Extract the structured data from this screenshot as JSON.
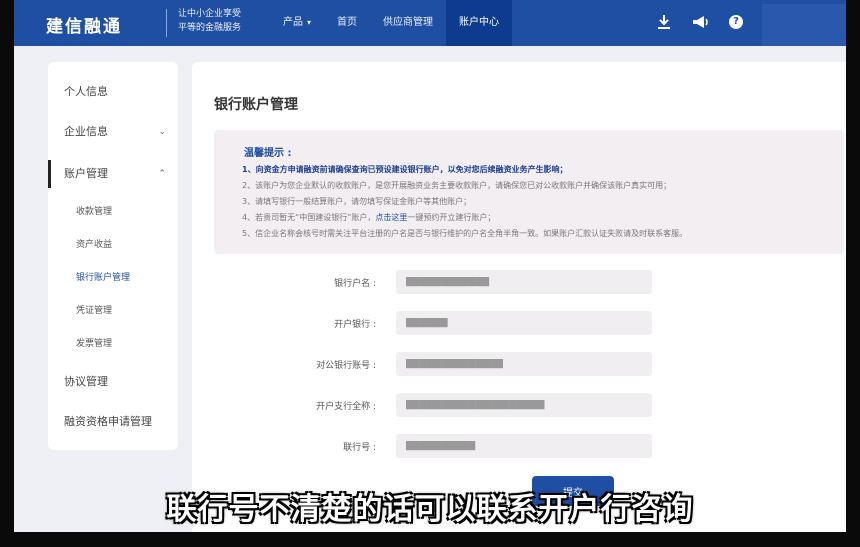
{
  "header": {
    "logo": "建信融通",
    "slogan_line1": "让中小企业享受",
    "slogan_line2": "平等的金融服务",
    "nav": [
      {
        "label": "产品",
        "has_dropdown": true
      },
      {
        "label": "首页"
      },
      {
        "label": "供应商管理"
      },
      {
        "label": "账户中心",
        "active": true
      }
    ],
    "icons": [
      "download-icon",
      "megaphone-icon",
      "help-icon"
    ],
    "help_glyph": "?"
  },
  "sidebar": {
    "items": [
      {
        "label": "个人信息"
      },
      {
        "label": "企业信息",
        "expand": "collapsed"
      },
      {
        "label": "账户管理",
        "expand": "expanded",
        "active": true
      },
      {
        "label": "协议管理"
      },
      {
        "label": "融资资格申请管理"
      }
    ],
    "sub_items": [
      {
        "label": "收款管理"
      },
      {
        "label": "资产收益"
      },
      {
        "label": "银行账户管理",
        "active": true
      },
      {
        "label": "凭证管理"
      },
      {
        "label": "发票管理"
      }
    ]
  },
  "main": {
    "title": "银行账户管理",
    "notice": {
      "title": "温馨提示 :",
      "lines": [
        "1、向资金方申请融资前请确保查询已预设建设银行账户，以免对您后续融资业务产生影响；",
        "2、该账户为您企业默认的收款账户，是您开展融资业务主要收款账户，请确保您已对公收款账户并确保该账户真实可用；",
        "3、请填写银行一般结算账户，请勿填写保证金账户等其他账户；",
        "4、若贵司暂无“中国建设银行”账户，",
        "5、信企业名称会核号时需关注平台注册的户名是否与银行维护的户名全角半角一致。如果账户汇款认证失败请及时联系客服。"
      ],
      "link_text": "点击这里",
      "line4_suffix": "一键预约开立建行账户；"
    },
    "form": {
      "fields": [
        {
          "label": "银行户名 :",
          "value": "████████████"
        },
        {
          "label": "开户银行 :",
          "value": "██████"
        },
        {
          "label": "对公银行账号 :",
          "value": "██████████████"
        },
        {
          "label": "开户支行全称 :",
          "value": "████████████████████"
        },
        {
          "label": "联行号 :",
          "value": "██████████"
        }
      ],
      "submit_label": "提交"
    }
  },
  "subtitle": "联行号不清楚的话可以联系开户行咨询"
}
